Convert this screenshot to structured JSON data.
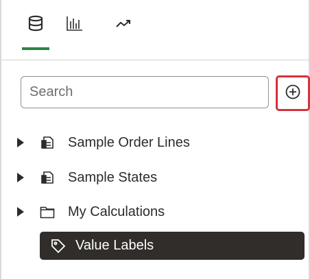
{
  "tabs": [
    {
      "id": "data",
      "icon": "database-icon",
      "selected": true
    },
    {
      "id": "visualizations",
      "icon": "bar-chart-icon",
      "selected": false
    },
    {
      "id": "analytics",
      "icon": "trend-line-icon",
      "selected": false
    }
  ],
  "colors": {
    "tab_underline": "#2e8540",
    "add_button_highlight": "#d5303b",
    "selected_item_bg": "#312d2a"
  },
  "search": {
    "placeholder": "Search",
    "value": ""
  },
  "add_button": {
    "icon": "plus-circle-icon"
  },
  "tree": {
    "items": [
      {
        "label": "Sample Order Lines",
        "icon": "dataset-icon",
        "expandable": true
      },
      {
        "label": "Sample States",
        "icon": "dataset-icon",
        "expandable": true
      },
      {
        "label": "My Calculations",
        "icon": "folder-icon",
        "expandable": true
      }
    ],
    "selected": {
      "label": "Value Labels",
      "icon": "tag-icon"
    }
  }
}
